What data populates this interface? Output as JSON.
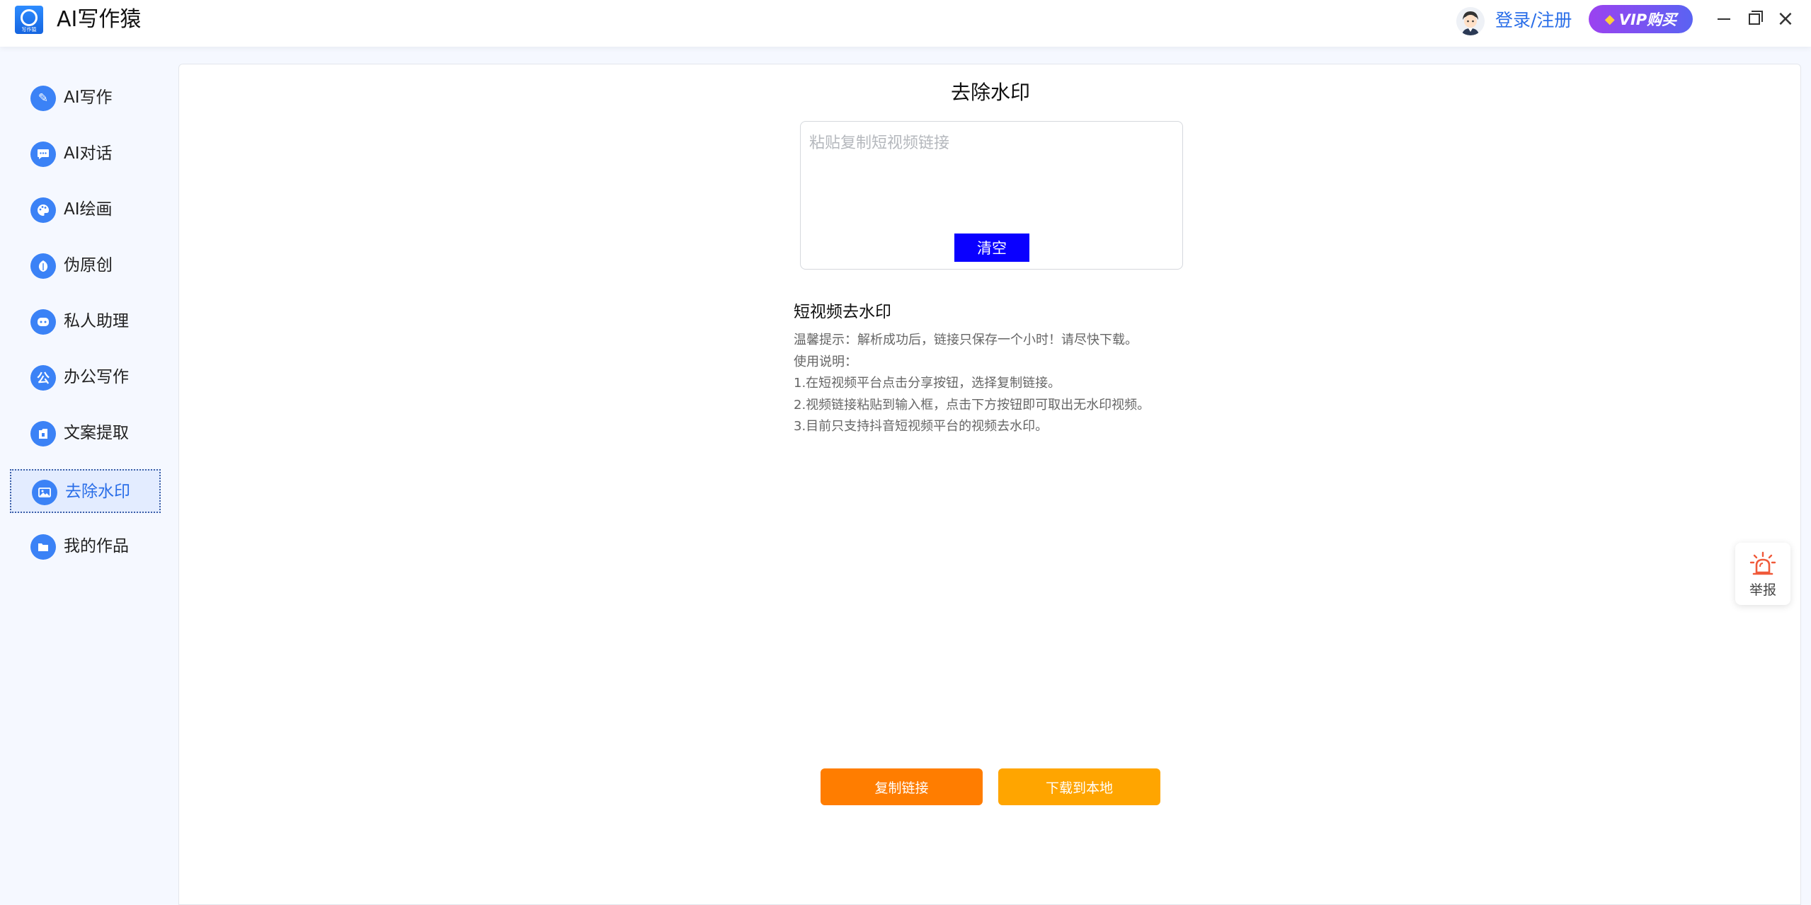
{
  "titlebar": {
    "app_logo_text": "写作猿",
    "app_title": "AI写作猿",
    "login_label": "登录/注册",
    "vip_label": "VIP购买"
  },
  "sidebar": {
    "items": [
      {
        "label": "AI写作",
        "icon": "pencil-icon"
      },
      {
        "label": "AI对话",
        "icon": "chat-icon"
      },
      {
        "label": "AI绘画",
        "icon": "palette-icon"
      },
      {
        "label": "伪原创",
        "icon": "leaf-icon"
      },
      {
        "label": "私人助理",
        "icon": "assistant-icon"
      },
      {
        "label": "办公写作",
        "icon": "office-icon"
      },
      {
        "label": "文案提取",
        "icon": "extract-icon"
      },
      {
        "label": "去除水印",
        "icon": "image-icon",
        "active": true
      },
      {
        "label": "我的作品",
        "icon": "folder-icon"
      }
    ]
  },
  "main": {
    "title": "去除水印",
    "input_placeholder": "粘贴复制短视频链接",
    "input_value": "",
    "clear_label": "清空",
    "instructions": {
      "title": "短视频去水印",
      "lines": [
        "温馨提示：解析成功后，链接只保存一个小时！请尽快下载。",
        "使用说明：",
        "1.在短视频平台点击分享按钮，选择复制链接。",
        "2.视频链接粘贴到输入框，点击下方按钮即可取出无水印视频。",
        "3.目前只支持抖音短视频平台的视频去水印。"
      ]
    },
    "copy_label": "复制链接",
    "download_label": "下载到本地"
  },
  "report": {
    "label": "举报"
  },
  "colors": {
    "accent": "#2a6ee8",
    "clear_button": "#0a00ff",
    "copy_button": "#ff7d00",
    "download_button": "#ffa500"
  }
}
